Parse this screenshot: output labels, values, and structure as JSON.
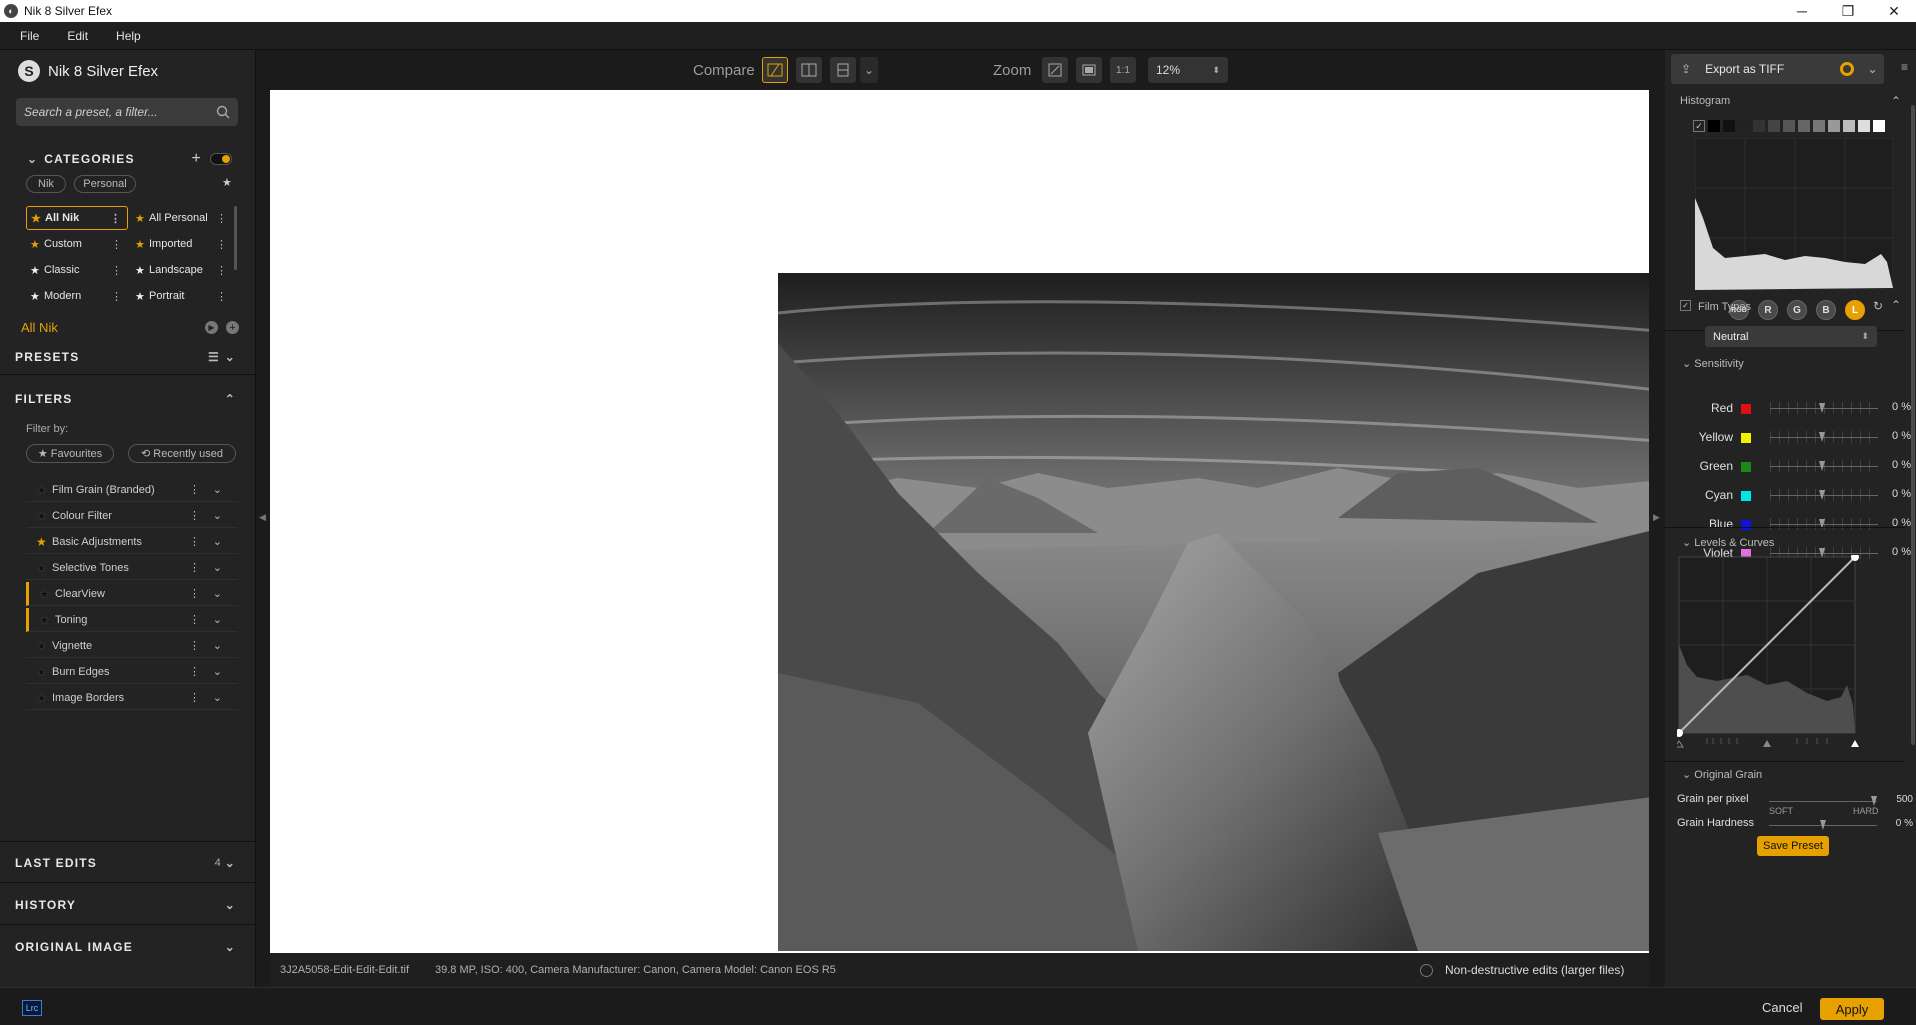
{
  "window": {
    "title": "Nik 8 Silver Efex",
    "minimize": "─",
    "maximize": "❐",
    "close": "✕"
  },
  "menu": [
    "File",
    "Edit",
    "Help"
  ],
  "left": {
    "app_name": "Nik 8 Silver Efex",
    "search_placeholder": "Search a preset, a filter...",
    "categories_label": "CATEGORIES",
    "tabs": [
      "Nik",
      "Personal"
    ],
    "categories": [
      {
        "label": "All Nik",
        "star": "gold",
        "selected": true
      },
      {
        "label": "All Personal",
        "star": "gold"
      },
      {
        "label": "Custom",
        "star": "gold"
      },
      {
        "label": "Imported",
        "star": "gold"
      },
      {
        "label": "Classic",
        "star": "dark"
      },
      {
        "label": "Landscape",
        "star": "dark"
      },
      {
        "label": "Modern",
        "star": "dark"
      },
      {
        "label": "Portrait",
        "star": "dark"
      }
    ],
    "current_category": "All Nik",
    "presets_label": "PRESETS",
    "filters_label": "FILTERS",
    "filter_by": "Filter by:",
    "favourites": "★ Favourites",
    "recently_used": "⟲ Recently used",
    "filters": [
      {
        "label": "Film Grain (Branded)",
        "star": "dark"
      },
      {
        "label": "Colour Filter",
        "star": "dark"
      },
      {
        "label": "Basic Adjustments",
        "star": "gold"
      },
      {
        "label": "Selective Tones",
        "star": "dark"
      },
      {
        "label": "ClearView",
        "star": "dark",
        "active": true
      },
      {
        "label": "Toning",
        "star": "dark",
        "active": true
      },
      {
        "label": "Vignette",
        "star": "dark"
      },
      {
        "label": "Burn Edges",
        "star": "dark"
      },
      {
        "label": "Image Borders",
        "star": "dark"
      }
    ],
    "last_edits_label": "LAST EDITS",
    "last_edits_count": "4",
    "history_label": "HISTORY",
    "original_image_label": "ORIGINAL IMAGE"
  },
  "toolbar": {
    "compare_label": "Compare",
    "zoom_label": "Zoom",
    "zoom_1to1": "1:1",
    "zoom_value": "12%"
  },
  "status": {
    "filename": "3J2A5058-Edit-Edit-Edit.tif",
    "info": "39.8 MP, ISO: 400, Camera Manufacturer: Canon, Camera Model: Canon EOS R5",
    "nondestructive": "Non-destructive edits (larger files)"
  },
  "right": {
    "export_label": "Export as TIFF",
    "histogram_label": "Histogram",
    "channels": [
      "RGB",
      "R",
      "G",
      "B",
      "L"
    ],
    "film_types_label": "Film Types",
    "film_type_value": "Neutral",
    "sensitivity_label": "Sensitivity",
    "sensitivity": [
      {
        "name": "Red",
        "color": "#e01010",
        "value": "0 %"
      },
      {
        "name": "Yellow",
        "color": "#f2f200",
        "value": "0 %"
      },
      {
        "name": "Green",
        "color": "#1a8a1a",
        "value": "0 %"
      },
      {
        "name": "Cyan",
        "color": "#00e6e6",
        "value": "0 %"
      },
      {
        "name": "Blue",
        "color": "#1010e0",
        "value": "0 %"
      },
      {
        "name": "Violet",
        "color": "#e070e0",
        "value": "0 %"
      }
    ],
    "levels_label": "Levels & Curves",
    "original_grain_label": "Original Grain",
    "grain_per_pixel_label": "Grain per pixel",
    "grain_per_pixel_value": "500",
    "soft_label": "SOFT",
    "hard_label": "HARD",
    "grain_hardness_label": "Grain Hardness",
    "grain_hardness_value": "0 %",
    "save_preset": "Save Preset"
  },
  "bottom": {
    "lrc_badge": "Lrc",
    "cancel": "Cancel",
    "apply": "Apply"
  },
  "colors": {
    "accent": "#e6a100",
    "panel": "#232323",
    "canvas": "#ffffff"
  }
}
